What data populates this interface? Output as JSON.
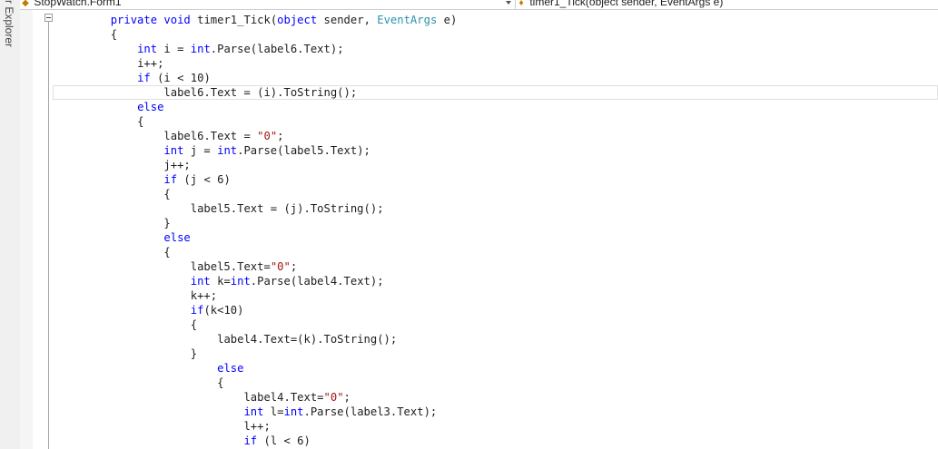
{
  "side_panel": {
    "tab_label": "r Explorer"
  },
  "navigation_bar": {
    "class_combo": {
      "icon": "class-icon",
      "value": "StopWatch.Form1"
    },
    "member_combo": {
      "icon": "method-icon",
      "value": "timer1_Tick(object sender, EventArgs e)"
    }
  },
  "colors": {
    "keyword": "#0000ff",
    "type": "#2b91af",
    "string": "#a31515",
    "text": "#1e1e1e"
  },
  "code_lines": [
    {
      "indent": 8,
      "tokens": [
        [
          "kw",
          "private"
        ],
        [
          "p",
          " "
        ],
        [
          "kw",
          "void"
        ],
        [
          "p",
          " timer1_Tick("
        ],
        [
          "kw",
          "object"
        ],
        [
          "p",
          " sender, "
        ],
        [
          "type",
          "EventArgs"
        ],
        [
          "p",
          " e)"
        ]
      ]
    },
    {
      "indent": 8,
      "tokens": [
        [
          "p",
          "{"
        ]
      ]
    },
    {
      "indent": 12,
      "tokens": [
        [
          "kw",
          "int"
        ],
        [
          "p",
          " i = "
        ],
        [
          "kw",
          "int"
        ],
        [
          "p",
          ".Parse(label6.Text);"
        ]
      ]
    },
    {
      "indent": 12,
      "tokens": [
        [
          "p",
          "i++;"
        ]
      ]
    },
    {
      "indent": 12,
      "tokens": [
        [
          "kw",
          "if"
        ],
        [
          "p",
          " (i < 10)"
        ]
      ]
    },
    {
      "indent": 16,
      "current": true,
      "tokens": [
        [
          "p",
          "label6.Text = (i).ToString();"
        ]
      ]
    },
    {
      "indent": 12,
      "tokens": [
        [
          "kw",
          "else"
        ]
      ]
    },
    {
      "indent": 12,
      "tokens": [
        [
          "p",
          "{"
        ]
      ]
    },
    {
      "indent": 16,
      "tokens": [
        [
          "p",
          "label6.Text = "
        ],
        [
          "str",
          "\"0\""
        ],
        [
          "p",
          ";"
        ]
      ]
    },
    {
      "indent": 16,
      "tokens": [
        [
          "kw",
          "int"
        ],
        [
          "p",
          " j = "
        ],
        [
          "kw",
          "int"
        ],
        [
          "p",
          ".Parse(label5.Text);"
        ]
      ]
    },
    {
      "indent": 16,
      "tokens": [
        [
          "p",
          "j++;"
        ]
      ]
    },
    {
      "indent": 16,
      "tokens": [
        [
          "kw",
          "if"
        ],
        [
          "p",
          " (j < 6)"
        ]
      ]
    },
    {
      "indent": 16,
      "tokens": [
        [
          "p",
          "{"
        ]
      ]
    },
    {
      "indent": 20,
      "tokens": [
        [
          "p",
          "label5.Text = (j).ToString();"
        ]
      ]
    },
    {
      "indent": 16,
      "tokens": [
        [
          "p",
          "}"
        ]
      ]
    },
    {
      "indent": 16,
      "tokens": [
        [
          "kw",
          "else"
        ]
      ]
    },
    {
      "indent": 16,
      "tokens": [
        [
          "p",
          "{"
        ]
      ]
    },
    {
      "indent": 20,
      "tokens": [
        [
          "p",
          "label5.Text="
        ],
        [
          "str",
          "\"0\""
        ],
        [
          "p",
          ";"
        ]
      ]
    },
    {
      "indent": 20,
      "tokens": [
        [
          "kw",
          "int"
        ],
        [
          "p",
          " k="
        ],
        [
          "kw",
          "int"
        ],
        [
          "p",
          ".Parse(label4.Text);"
        ]
      ]
    },
    {
      "indent": 20,
      "tokens": [
        [
          "p",
          "k++;"
        ]
      ]
    },
    {
      "indent": 20,
      "tokens": [
        [
          "kw",
          "if"
        ],
        [
          "p",
          "(k<10)"
        ]
      ]
    },
    {
      "indent": 20,
      "tokens": [
        [
          "p",
          "{"
        ]
      ]
    },
    {
      "indent": 24,
      "tokens": [
        [
          "p",
          "label4.Text=(k).ToString();"
        ]
      ]
    },
    {
      "indent": 20,
      "tokens": [
        [
          "p",
          "}"
        ]
      ]
    },
    {
      "indent": 24,
      "tokens": [
        [
          "kw",
          "else"
        ]
      ]
    },
    {
      "indent": 24,
      "tokens": [
        [
          "p",
          "{"
        ]
      ]
    },
    {
      "indent": 28,
      "tokens": [
        [
          "p",
          "label4.Text="
        ],
        [
          "str",
          "\"0\""
        ],
        [
          "p",
          ";"
        ]
      ]
    },
    {
      "indent": 28,
      "tokens": [
        [
          "kw",
          "int"
        ],
        [
          "p",
          " l="
        ],
        [
          "kw",
          "int"
        ],
        [
          "p",
          ".Parse(label3.Text);"
        ]
      ]
    },
    {
      "indent": 28,
      "tokens": [
        [
          "p",
          "l++;"
        ]
      ]
    },
    {
      "indent": 28,
      "tokens": [
        [
          "kw",
          "if"
        ],
        [
          "p",
          " (l < 6)"
        ]
      ]
    }
  ]
}
